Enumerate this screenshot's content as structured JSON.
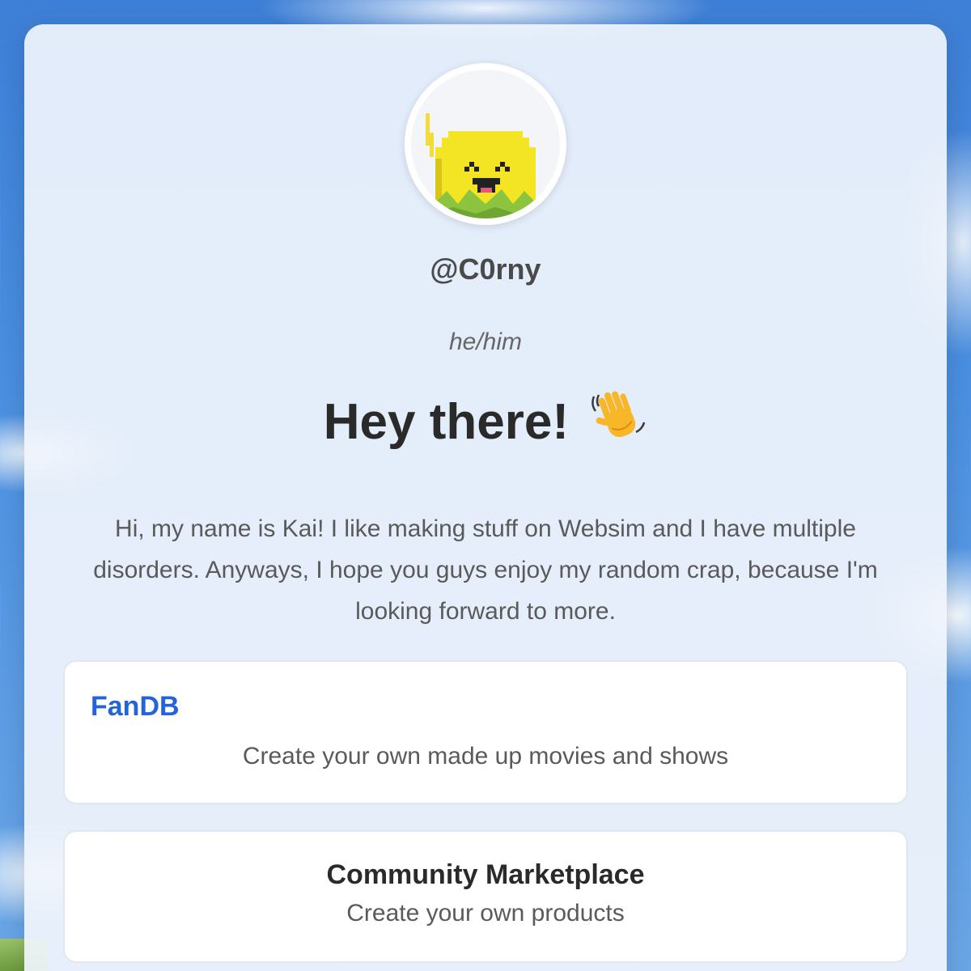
{
  "profile": {
    "username": "@C0rny",
    "pronouns": "he/him",
    "avatar_icon": "pixel-corn-mascot-icon"
  },
  "greeting": {
    "text": "Hey there!",
    "emoji_icon": "waving-hand-icon"
  },
  "bio": "Hi, my name is Kai! I like making stuff on Websim and I have multiple disorders. Anyways, I hope you guys enjoy my random crap, because I'm looking forward to more.",
  "links": [
    {
      "title": "FanDB",
      "description": "Create your own made up movies and shows"
    },
    {
      "title": "Community Marketplace",
      "description": "Create your own products"
    }
  ],
  "colors": {
    "link_accent": "#2563d9",
    "heading": "#2a2a2a",
    "body_text": "#5a5a5a"
  }
}
